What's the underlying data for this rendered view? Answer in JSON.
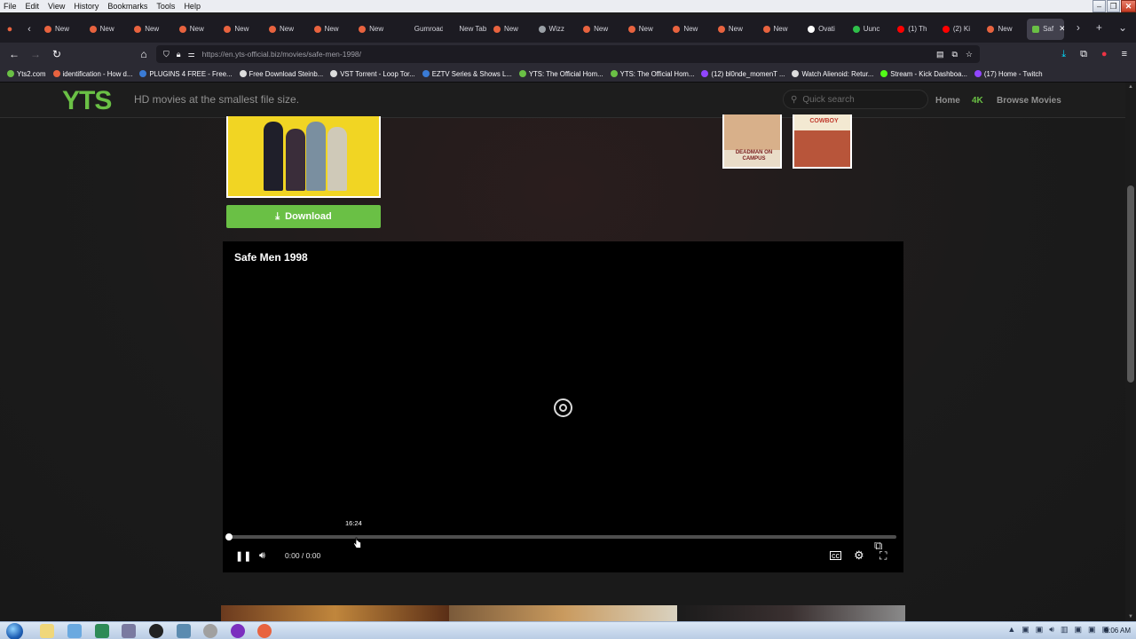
{
  "menubar": {
    "items": [
      "File",
      "Edit",
      "View",
      "History",
      "Bookmarks",
      "Tools",
      "Help"
    ]
  },
  "tabs": [
    {
      "label": "New",
      "color": "#e8633f"
    },
    {
      "label": "New",
      "color": "#e8633f"
    },
    {
      "label": "New",
      "color": "#e8633f"
    },
    {
      "label": "New",
      "color": "#e8633f"
    },
    {
      "label": "New",
      "color": "#e8633f"
    },
    {
      "label": "New",
      "color": "#e8633f"
    },
    {
      "label": "New",
      "color": "#e8633f"
    },
    {
      "label": "New",
      "color": "#e8633f"
    },
    {
      "label": "Gumroad",
      "color": ""
    },
    {
      "label": "New Tab",
      "color": ""
    },
    {
      "label": "New",
      "color": "#e8633f"
    },
    {
      "label": "Wizz",
      "color": "#9aa0a6"
    },
    {
      "label": "New",
      "color": "#e8633f"
    },
    {
      "label": "New",
      "color": "#e8633f"
    },
    {
      "label": "New",
      "color": "#e8633f"
    },
    {
      "label": "New",
      "color": "#e8633f"
    },
    {
      "label": "New",
      "color": "#e8633f"
    },
    {
      "label": "Ovati",
      "color": "#ffffff"
    },
    {
      "label": "Uunc",
      "color": "#2fbf4a"
    },
    {
      "label": "(1) Th",
      "color": "#ff0000"
    },
    {
      "label": "(2) Ki",
      "color": "#ff0000"
    },
    {
      "label": "New",
      "color": "#e8633f"
    }
  ],
  "active_tab": {
    "label": "Saf"
  },
  "address": {
    "url": "https://en.yts-official.biz/movies/safe-men-1998/"
  },
  "bookmarks": [
    {
      "label": "Yts2.com",
      "color": "#6ac045"
    },
    {
      "label": "identification - How d...",
      "color": "#e8633f"
    },
    {
      "label": "PLUGINS 4 FREE - Free...",
      "color": "#3a7bd5"
    },
    {
      "label": "Free Download Steinb...",
      "color": "#dddddd"
    },
    {
      "label": "VST Torrent - Loop Tor...",
      "color": "#dddddd"
    },
    {
      "label": "EZTV Series & Shows L...",
      "color": "#3a7bd5"
    },
    {
      "label": "YTS: The Official Hom...",
      "color": "#6ac045"
    },
    {
      "label": "YTS: The Official Hom...",
      "color": "#6ac045"
    },
    {
      "label": "(12) bl0nde_momenT ...",
      "color": "#9146ff"
    },
    {
      "label": "Watch Alienoid: Retur...",
      "color": "#dddddd"
    },
    {
      "label": "Stream - Kick Dashboa...",
      "color": "#53fc18"
    },
    {
      "label": "(17) Home - Twitch",
      "color": "#9146ff"
    }
  ],
  "site": {
    "logo": "YTS",
    "tagline": "HD movies at the smallest file size.",
    "search_placeholder": "Quick search",
    "nav": {
      "home": "Home",
      "fourk": "4K",
      "browse": "Browse Movies"
    },
    "accent": "#6ac045"
  },
  "download": {
    "label": "Download"
  },
  "similar": [
    {
      "title": "DEADMAN ON CAMPUS"
    },
    {
      "title": "COWBOY"
    }
  ],
  "player": {
    "title": "Safe Men 1998",
    "hover_time": "16:24",
    "time": "0:00 / 0:00"
  },
  "taskbar": {
    "clock": "9:06 AM"
  }
}
